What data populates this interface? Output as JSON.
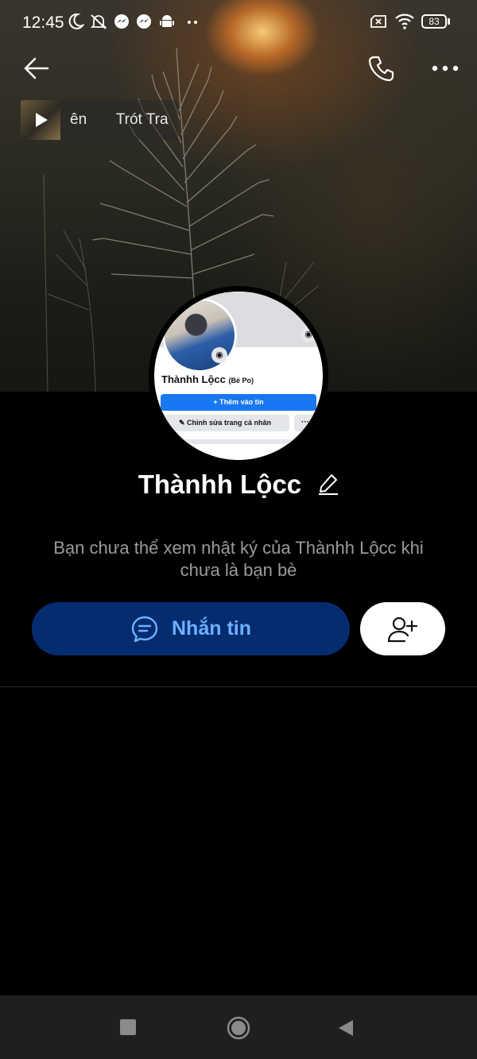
{
  "status_bar": {
    "time": "12:45",
    "battery": "83",
    "icons": [
      "moon-icon",
      "muted-bell-icon",
      "messenger-icon",
      "messenger-icon",
      "android-icon",
      "more-dots-icon",
      "no-sim-icon",
      "wifi-icon",
      "battery-icon"
    ]
  },
  "top_nav": {
    "back_icon": "arrow-left-icon",
    "call_icon": "phone-icon",
    "more_icon": "more-horizontal-icon"
  },
  "music": {
    "text": "ên       Trót Tra",
    "play_icon": "play-icon"
  },
  "avatar_screenshot": {
    "name": "Thànhh Lộcc",
    "nickname": "(Bé Po)",
    "add_story": "+ Thêm vào tin",
    "edit_profile": "Chỉnh sửa trang cá nhân",
    "more": "···"
  },
  "profile": {
    "name": "Thànhh Lộcc",
    "notice": "Bạn chưa thể xem nhật ký của Thànhh Lộcc khi chưa là bạn bè"
  },
  "actions": {
    "message_label": "Nhắn tin",
    "message_icon": "chat-bubble-icon",
    "add_friend_icon": "add-friend-icon"
  },
  "colors": {
    "message_button_bg": "#062c70",
    "message_button_text": "#6cb1ff",
    "background": "#000000"
  }
}
